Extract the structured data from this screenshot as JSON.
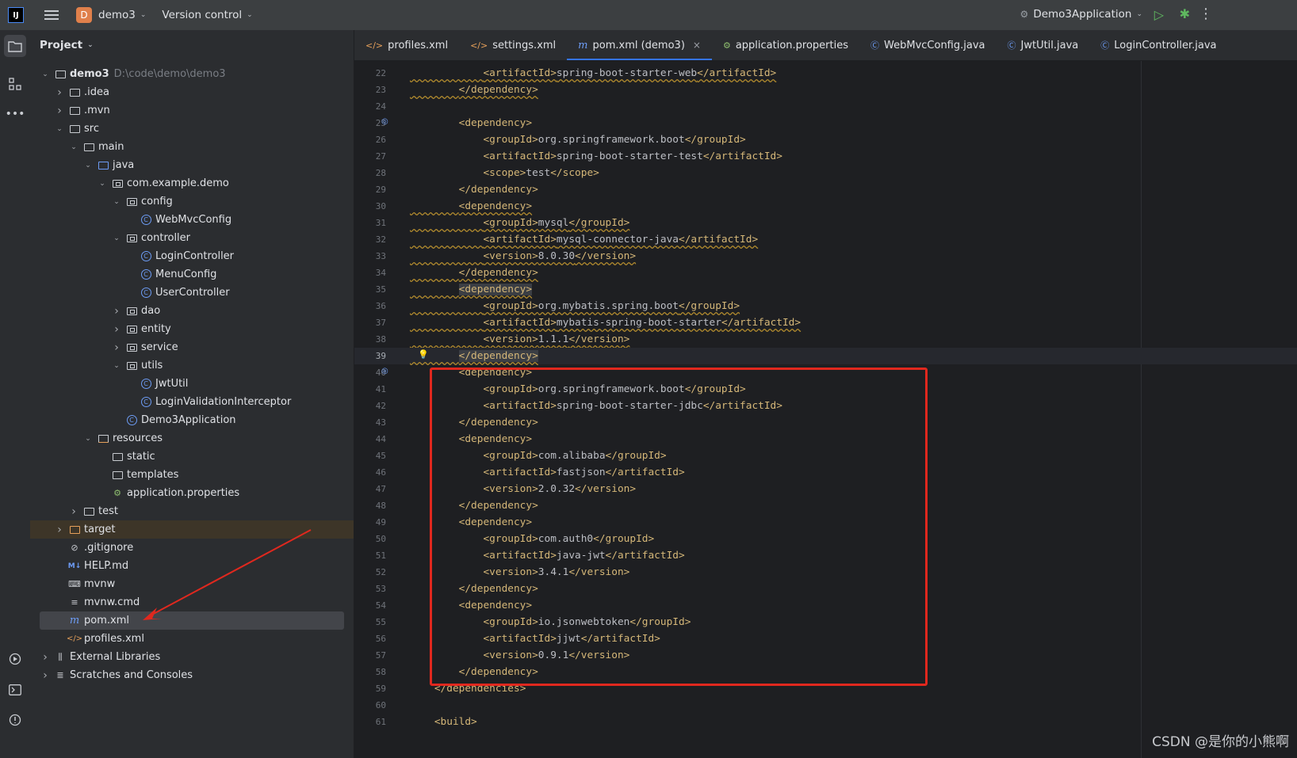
{
  "titlebar": {
    "logo": "IJ",
    "project_badge": "D",
    "project_name": "demo3",
    "vcs": "Version control",
    "run_config": "Demo3Application"
  },
  "toolstrip": {
    "icons": [
      "project-folder-icon",
      "structure-icon",
      "more-icon",
      "services-icon",
      "terminal-icon",
      "problems-icon"
    ]
  },
  "project_panel": {
    "title": "Project",
    "tree": [
      {
        "label": "demo3",
        "path": "D:\\code\\demo\\demo3",
        "depth": 0,
        "arrow": "down",
        "icon": "folder"
      },
      {
        "label": ".idea",
        "depth": 1,
        "arrow": "right",
        "icon": "folder"
      },
      {
        "label": ".mvn",
        "depth": 1,
        "arrow": "right",
        "icon": "folder"
      },
      {
        "label": "src",
        "depth": 1,
        "arrow": "down",
        "icon": "folder"
      },
      {
        "label": "main",
        "depth": 2,
        "arrow": "down",
        "icon": "folder"
      },
      {
        "label": "java",
        "depth": 3,
        "arrow": "down",
        "icon": "folder-blue"
      },
      {
        "label": "com.example.demo",
        "depth": 4,
        "arrow": "down",
        "icon": "package"
      },
      {
        "label": "config",
        "depth": 5,
        "arrow": "down",
        "icon": "package"
      },
      {
        "label": "WebMvcConfig",
        "depth": 6,
        "arrow": "",
        "icon": "class"
      },
      {
        "label": "controller",
        "depth": 5,
        "arrow": "down",
        "icon": "package"
      },
      {
        "label": "LoginController",
        "depth": 6,
        "arrow": "",
        "icon": "class"
      },
      {
        "label": "MenuConfig",
        "depth": 6,
        "arrow": "",
        "icon": "class"
      },
      {
        "label": "UserController",
        "depth": 6,
        "arrow": "",
        "icon": "class"
      },
      {
        "label": "dao",
        "depth": 5,
        "arrow": "right",
        "icon": "package"
      },
      {
        "label": "entity",
        "depth": 5,
        "arrow": "right",
        "icon": "package"
      },
      {
        "label": "service",
        "depth": 5,
        "arrow": "right",
        "icon": "package"
      },
      {
        "label": "utils",
        "depth": 5,
        "arrow": "down",
        "icon": "package"
      },
      {
        "label": "JwtUtil",
        "depth": 6,
        "arrow": "",
        "icon": "class"
      },
      {
        "label": "LoginValidationInterceptor",
        "depth": 6,
        "arrow": "",
        "icon": "class"
      },
      {
        "label": "Demo3Application",
        "depth": 5,
        "arrow": "",
        "icon": "class"
      },
      {
        "label": "resources",
        "depth": 3,
        "arrow": "down",
        "icon": "folder-res"
      },
      {
        "label": "static",
        "depth": 4,
        "arrow": "",
        "icon": "folder"
      },
      {
        "label": "templates",
        "depth": 4,
        "arrow": "",
        "icon": "folder"
      },
      {
        "label": "application.properties",
        "depth": 4,
        "arrow": "",
        "icon": "properties"
      },
      {
        "label": "test",
        "depth": 2,
        "arrow": "right",
        "icon": "folder"
      },
      {
        "label": "target",
        "depth": 1,
        "arrow": "right",
        "icon": "folder-orange",
        "highlight": true
      },
      {
        "label": ".gitignore",
        "depth": 1,
        "arrow": "",
        "icon": "gitignore"
      },
      {
        "label": "HELP.md",
        "depth": 1,
        "arrow": "",
        "icon": "markdown"
      },
      {
        "label": "mvnw",
        "depth": 1,
        "arrow": "",
        "icon": "shell"
      },
      {
        "label": "mvnw.cmd",
        "depth": 1,
        "arrow": "",
        "icon": "text"
      },
      {
        "label": "pom.xml",
        "depth": 1,
        "arrow": "",
        "icon": "maven",
        "selected": true
      },
      {
        "label": "profiles.xml",
        "depth": 1,
        "arrow": "",
        "icon": "xml"
      },
      {
        "label": "External Libraries",
        "depth": 0,
        "arrow": "right",
        "icon": "library"
      },
      {
        "label": "Scratches and Consoles",
        "depth": 0,
        "arrow": "right",
        "icon": "scratches"
      }
    ]
  },
  "tabs": [
    {
      "label": "profiles.xml",
      "icon": "xml"
    },
    {
      "label": "settings.xml",
      "icon": "xml"
    },
    {
      "label": "pom.xml (demo3)",
      "icon": "maven",
      "active": true
    },
    {
      "label": "application.properties",
      "icon": "properties"
    },
    {
      "label": "WebMvcConfig.java",
      "icon": "class"
    },
    {
      "label": "JwtUtil.java",
      "icon": "class"
    },
    {
      "label": "LoginController.java",
      "icon": "class"
    }
  ],
  "editor": {
    "current_line": 39,
    "lines": [
      {
        "n": 22,
        "indent": 3,
        "open": "artifactId",
        "text": "spring-boot-starter-web",
        "warn": true
      },
      {
        "n": 23,
        "indent": 2,
        "close": "dependency",
        "warn": true
      },
      {
        "n": 24,
        "indent": 0,
        "empty": true
      },
      {
        "n": 25,
        "indent": 2,
        "open": "dependency",
        "gutter": true
      },
      {
        "n": 26,
        "indent": 3,
        "open": "groupId",
        "text": "org.springframework.boot"
      },
      {
        "n": 27,
        "indent": 3,
        "open": "artifactId",
        "text": "spring-boot-starter-test"
      },
      {
        "n": 28,
        "indent": 3,
        "open": "scope",
        "text": "test"
      },
      {
        "n": 29,
        "indent": 2,
        "close": "dependency"
      },
      {
        "n": 30,
        "indent": 2,
        "open": "dependency",
        "warn": true
      },
      {
        "n": 31,
        "indent": 3,
        "open": "groupId",
        "text": "mysql",
        "warn": true
      },
      {
        "n": 32,
        "indent": 3,
        "open": "artifactId",
        "text": "mysql-connector-java",
        "warn": true
      },
      {
        "n": 33,
        "indent": 3,
        "open": "version",
        "text": "8.0.30",
        "warn": true
      },
      {
        "n": 34,
        "indent": 2,
        "close": "dependency",
        "warn": true
      },
      {
        "n": 35,
        "indent": 2,
        "open": "dependency",
        "warn": true,
        "match": true
      },
      {
        "n": 36,
        "indent": 3,
        "open": "groupId",
        "text": "org.mybatis.spring.boot",
        "warn": true
      },
      {
        "n": 37,
        "indent": 3,
        "open": "artifactId",
        "text": "mybatis-spring-boot-starter",
        "warn": true
      },
      {
        "n": 38,
        "indent": 3,
        "open": "version",
        "text": "1.1.1",
        "warn": true
      },
      {
        "n": 39,
        "indent": 2,
        "close": "dependency",
        "warn": true,
        "match": true,
        "bulb": true
      },
      {
        "n": 40,
        "indent": 2,
        "open": "dependency",
        "gutter": true
      },
      {
        "n": 41,
        "indent": 3,
        "open": "groupId",
        "text": "org.springframework.boot"
      },
      {
        "n": 42,
        "indent": 3,
        "open": "artifactId",
        "text": "spring-boot-starter-jdbc"
      },
      {
        "n": 43,
        "indent": 2,
        "close": "dependency"
      },
      {
        "n": 44,
        "indent": 2,
        "open": "dependency"
      },
      {
        "n": 45,
        "indent": 3,
        "open": "groupId",
        "text": "com.alibaba"
      },
      {
        "n": 46,
        "indent": 3,
        "open": "artifactId",
        "text": "fastjson"
      },
      {
        "n": 47,
        "indent": 3,
        "open": "version",
        "text": "2.0.32"
      },
      {
        "n": 48,
        "indent": 2,
        "close": "dependency"
      },
      {
        "n": 49,
        "indent": 2,
        "open": "dependency"
      },
      {
        "n": 50,
        "indent": 3,
        "open": "groupId",
        "text": "com.auth0"
      },
      {
        "n": 51,
        "indent": 3,
        "open": "artifactId",
        "text": "java-jwt"
      },
      {
        "n": 52,
        "indent": 3,
        "open": "version",
        "text": "3.4.1"
      },
      {
        "n": 53,
        "indent": 2,
        "close": "dependency"
      },
      {
        "n": 54,
        "indent": 2,
        "open": "dependency"
      },
      {
        "n": 55,
        "indent": 3,
        "open": "groupId",
        "text": "io.jsonwebtoken"
      },
      {
        "n": 56,
        "indent": 3,
        "open": "artifactId",
        "text": "jjwt"
      },
      {
        "n": 57,
        "indent": 3,
        "open": "version",
        "text": "0.9.1"
      },
      {
        "n": 58,
        "indent": 2,
        "close": "dependency"
      },
      {
        "n": 59,
        "indent": 1,
        "close": "dependencies"
      },
      {
        "n": 60,
        "indent": 0,
        "empty": true
      },
      {
        "n": 61,
        "indent": 1,
        "open": "build"
      }
    ]
  },
  "watermark": "CSDN @是你的小熊啊",
  "colors": {
    "annotation_red": "#e0281e",
    "xml_tag": "#d5b778",
    "accent": "#3574f0"
  }
}
